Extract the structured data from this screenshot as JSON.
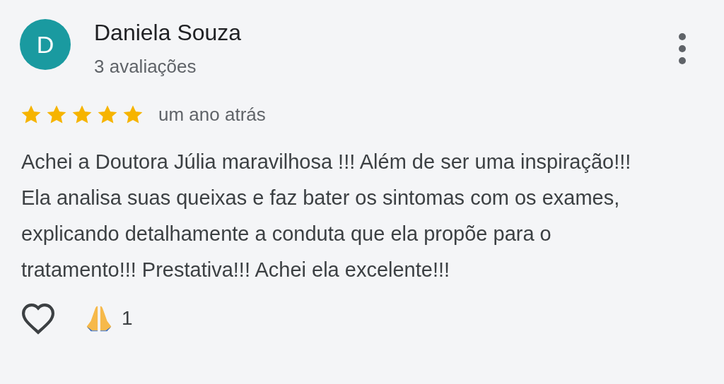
{
  "review": {
    "avatar_letter": "D",
    "author": "Daniela Souza",
    "author_meta": "3 avaliações",
    "stars": 5,
    "time": "um ano atrás",
    "text": "Achei a Doutora Júlia maravilhosa !!! Além de ser uma inspiração!!! Ela analisa suas queixas e faz bater os sintomas com os exames, explicando detalhamente a conduta que ela propõe para o tratamento!!! Prestativa!!! Achei ela excelente!!!",
    "liked": false,
    "reaction_count": "1"
  }
}
